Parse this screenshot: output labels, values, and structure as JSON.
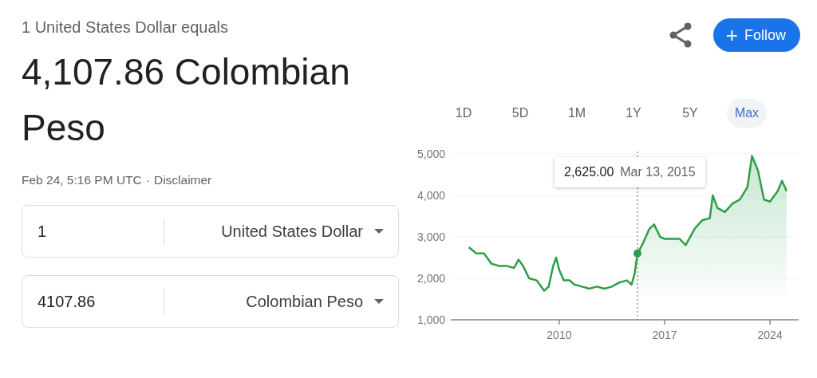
{
  "header": {
    "subtitle": "1 United States Dollar equals",
    "result": "4,107.86 Colombian Peso",
    "timestamp": "Feb 24, 5:16 PM UTC",
    "separator": "·",
    "disclaimer": "Disclaimer"
  },
  "actions": {
    "follow": {
      "icon": "+",
      "label": "Follow"
    }
  },
  "converter": [
    {
      "amount": "1",
      "currency": "United States Dollar"
    },
    {
      "amount": "4107.86",
      "currency": "Colombian Peso"
    }
  ],
  "ranges": [
    {
      "label": "1D",
      "selected": false
    },
    {
      "label": "5D",
      "selected": false
    },
    {
      "label": "1M",
      "selected": false
    },
    {
      "label": "1Y",
      "selected": false
    },
    {
      "label": "5Y",
      "selected": false
    },
    {
      "label": "Max",
      "selected": true
    }
  ],
  "chart": {
    "tooltip": {
      "value": "2,625.00",
      "date": "Mar 13, 2015"
    },
    "chart_data": {
      "type": "line",
      "grid": true,
      "xlim": [
        2002.8,
        2025.9
      ],
      "ylim": [
        1000,
        5000
      ],
      "xticks": [
        2010,
        2017,
        2024
      ],
      "yticks": [
        {
          "value": 1000,
          "label": "1,000"
        },
        {
          "value": 2000,
          "label": "2,000"
        },
        {
          "value": 3000,
          "label": "3,000"
        },
        {
          "value": 4000,
          "label": "4,000"
        },
        {
          "value": 5000,
          "label": "5,000"
        }
      ],
      "x": [
        2004.0,
        2004.5,
        2005.0,
        2005.5,
        2006.0,
        2006.5,
        2007.0,
        2007.3,
        2007.6,
        2008.0,
        2008.5,
        2009.0,
        2009.3,
        2009.6,
        2009.8,
        2010.0,
        2010.3,
        2010.7,
        2011.0,
        2011.5,
        2012.0,
        2012.5,
        2013.0,
        2013.5,
        2014.0,
        2014.5,
        2014.8,
        2015.0,
        2015.2,
        2015.5,
        2016.0,
        2016.3,
        2016.7,
        2017.0,
        2017.5,
        2018.0,
        2018.4,
        2019.0,
        2019.5,
        2020.0,
        2020.2,
        2020.5,
        2021.0,
        2021.5,
        2022.0,
        2022.5,
        2022.8,
        2023.2,
        2023.6,
        2024.0,
        2024.5,
        2024.8,
        2025.1
      ],
      "series": [
        {
          "color": "#2e9e48",
          "values": [
            2750,
            2600,
            2600,
            2350,
            2300,
            2300,
            2250,
            2450,
            2300,
            2000,
            1950,
            1700,
            1800,
            2300,
            2500,
            2200,
            1950,
            1950,
            1850,
            1800,
            1750,
            1800,
            1750,
            1800,
            1900,
            1950,
            1850,
            2100,
            2600,
            2800,
            3200,
            3300,
            3000,
            2950,
            2950,
            2950,
            2800,
            3200,
            3400,
            3450,
            4000,
            3700,
            3600,
            3800,
            3900,
            4200,
            4950,
            4600,
            3900,
            3850,
            4100,
            4350,
            4100
          ]
        }
      ],
      "ref_lines": [
        {
          "axis": "x",
          "value": 2015.2
        }
      ]
    }
  }
}
